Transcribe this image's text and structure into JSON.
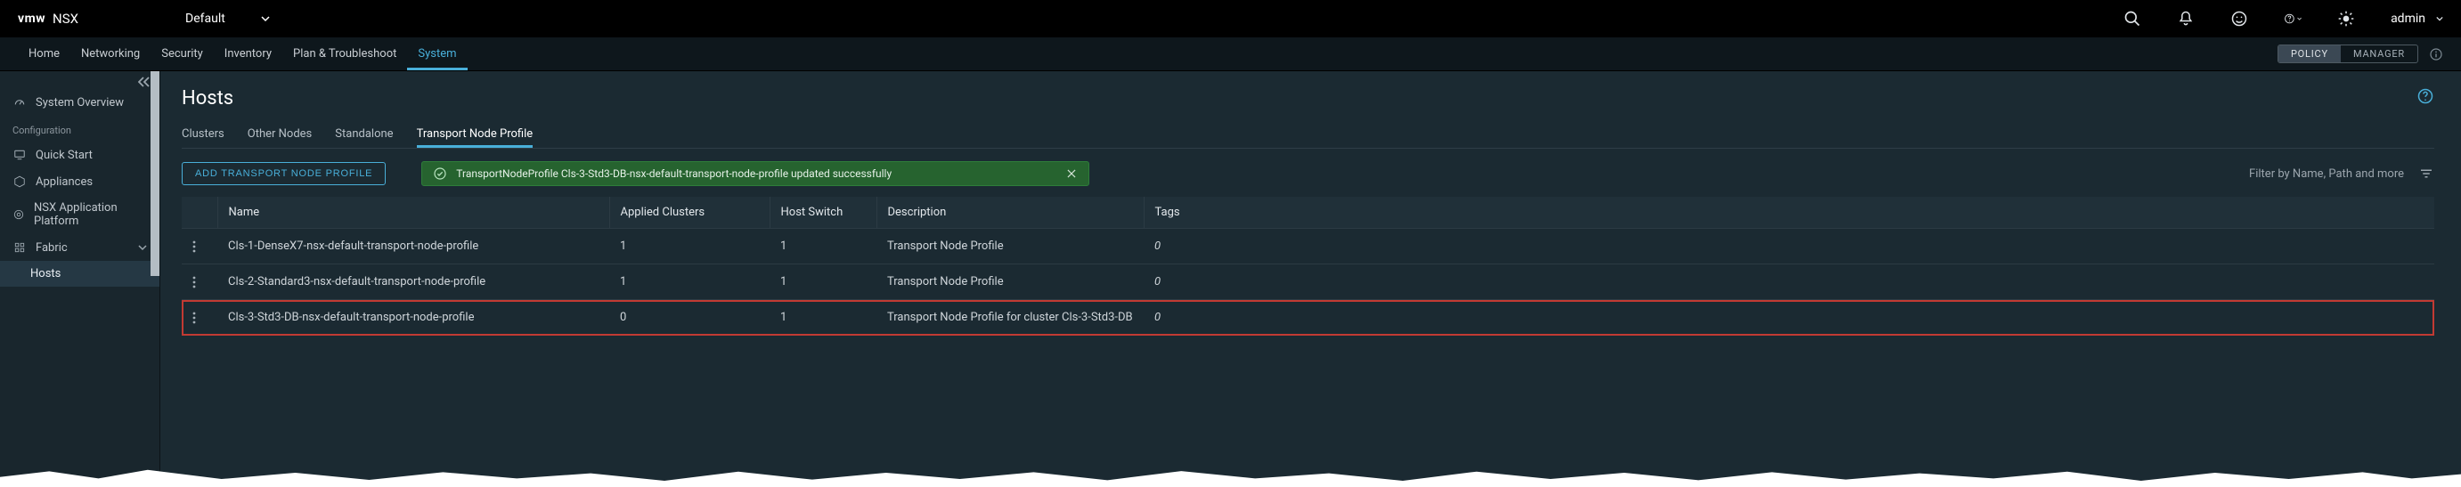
{
  "brand": {
    "logo_text": "vmw",
    "product": "NSX"
  },
  "env": {
    "label": "Default"
  },
  "top_icons": {
    "search": "search-icon",
    "bell": "bell-icon",
    "face": "smile-icon",
    "help": "help-icon",
    "theme": "sun-icon"
  },
  "user": {
    "name": "admin"
  },
  "nav_items": [
    "Home",
    "Networking",
    "Security",
    "Inventory",
    "Plan & Troubleshoot",
    "System"
  ],
  "nav_active_index": 5,
  "mode_toggle": {
    "left": "POLICY",
    "right": "MANAGER"
  },
  "sidebar": {
    "overview": "System Overview",
    "config_label": "Configuration",
    "items": [
      {
        "label": "Quick Start"
      },
      {
        "label": "Appliances"
      },
      {
        "label": "NSX Application Platform"
      },
      {
        "label": "Fabric",
        "expandable": true
      },
      {
        "label": "Hosts",
        "sub": true,
        "active": true
      }
    ]
  },
  "page": {
    "title": "Hosts",
    "tabs": [
      "Clusters",
      "Other Nodes",
      "Standalone",
      "Transport Node Profile"
    ],
    "active_tab_index": 3,
    "add_button": "ADD TRANSPORT NODE PROFILE",
    "banner_text": "TransportNodeProfile Cls-3-Std3-DB-nsx-default-transport-node-profile updated successfully",
    "filter_placeholder": "Filter by Name, Path and more"
  },
  "table": {
    "columns": [
      "Name",
      "Applied Clusters",
      "Host Switch",
      "Description",
      "Tags"
    ],
    "rows": [
      {
        "name": "Cls-1-DenseX7-nsx-default-transport-node-profile",
        "applied_clusters": "1",
        "applied_link": true,
        "host_switch": "1",
        "hostswitch_link": true,
        "description": "Transport Node Profile",
        "tags": "0"
      },
      {
        "name": "Cls-2-Standard3-nsx-default-transport-node-profile",
        "applied_clusters": "1",
        "applied_link": true,
        "host_switch": "1",
        "hostswitch_link": true,
        "description": "Transport Node Profile",
        "tags": "0"
      },
      {
        "name": "Cls-3-Std3-DB-nsx-default-transport-node-profile",
        "applied_clusters": "0",
        "applied_link": false,
        "host_switch": "1",
        "hostswitch_link": true,
        "description": "Transport Node Profile for cluster Cls-3-Std3-DB",
        "tags": "0",
        "highlight": true
      }
    ]
  }
}
